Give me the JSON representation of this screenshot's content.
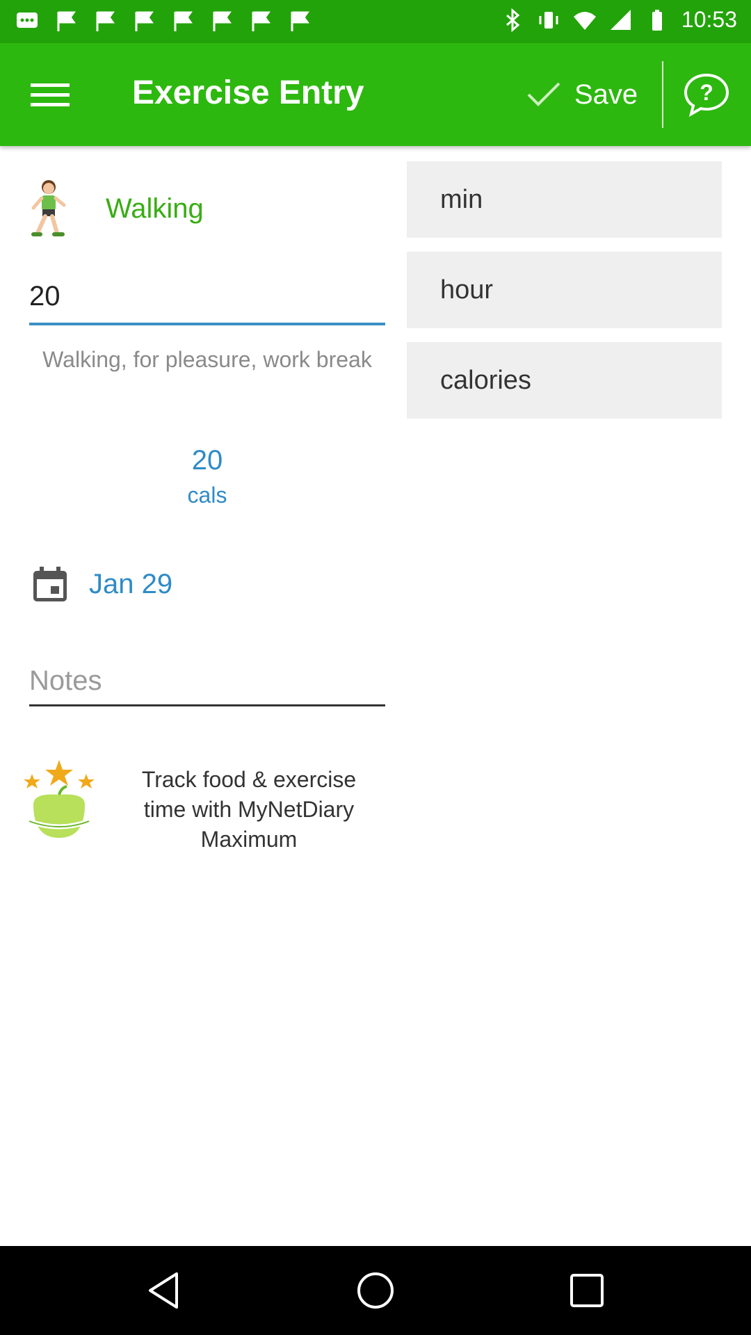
{
  "status_bar": {
    "time": "10:53"
  },
  "app_bar": {
    "title": "Exercise Entry",
    "save_label": "Save"
  },
  "activity": {
    "name": "Walking",
    "duration_value": "20",
    "description": "Walking, for pleasure, work break",
    "calories": "20",
    "calories_unit": "cals"
  },
  "units": [
    {
      "label": "min"
    },
    {
      "label": "hour"
    },
    {
      "label": "calories"
    }
  ],
  "date": {
    "label": "Jan 29"
  },
  "notes": {
    "placeholder": "Notes"
  },
  "promo": {
    "text": "Track food & exercise time with MyNetDiary Maximum"
  },
  "colors": {
    "app_bar": "#2db80f",
    "status_bar": "#23a30a",
    "accent_green": "#39ad14",
    "accent_blue": "#2e8bc7",
    "unit_bg": "#efefef"
  }
}
